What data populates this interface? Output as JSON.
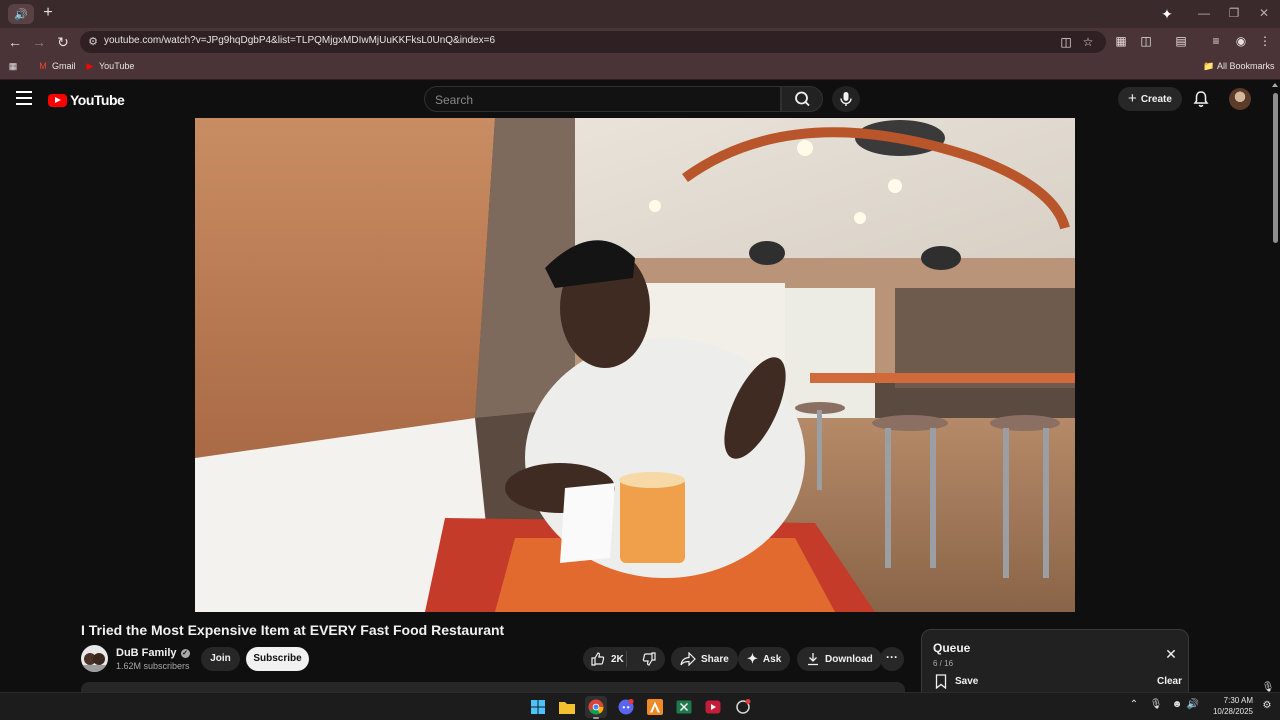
{
  "browser": {
    "tab_icon": "speaker-icon",
    "url": "youtube.com/watch?v=JPg9hqDgbP4&list=TLPQMjgxMDIwMjUuKKFksL0UnQ&index=6",
    "bookmarks": [
      {
        "label": "Gmail",
        "icon": "gmail-icon"
      },
      {
        "label": "YouTube",
        "icon": "youtube-icon"
      }
    ],
    "all_bookmarks_label": "All Bookmarks"
  },
  "youtube": {
    "logo_text": "YouTube",
    "search_placeholder": "Search",
    "create_label": "Create"
  },
  "video": {
    "title": "I Tried the Most Expensive Item at EVERY Fast Food Restaurant",
    "channel_name": "DuB Family",
    "subscribers": "1.62M subscribers",
    "join_label": "Join",
    "subscribe_label": "Subscribe",
    "likes": "2K",
    "share_label": "Share",
    "ask_label": "Ask",
    "download_label": "Download"
  },
  "queue": {
    "title": "Queue",
    "count": "6 / 16",
    "save_label": "Save",
    "clear_label": "Clear"
  },
  "taskbar": {
    "time": "7:30 AM",
    "date": "10/28/2025"
  },
  "colors": {
    "accent_red": "#ff0000",
    "chrome_frame": "#3b2a2c",
    "chrome_toolbar": "#4a3437",
    "page_bg": "#0f0f0f"
  }
}
